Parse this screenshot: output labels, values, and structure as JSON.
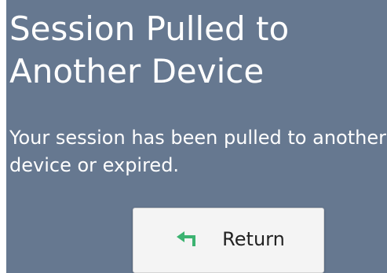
{
  "dialog": {
    "title": "Session Pulled to Another Device",
    "message": "Your session has been pulled to another device or expired."
  },
  "return_button": {
    "label": "Return",
    "icon": "return-arrow-icon",
    "icon_color": "#3cb371"
  },
  "colors": {
    "panel_background": "#667890",
    "text": "#ffffff",
    "button_background": "#f4f4f4"
  }
}
